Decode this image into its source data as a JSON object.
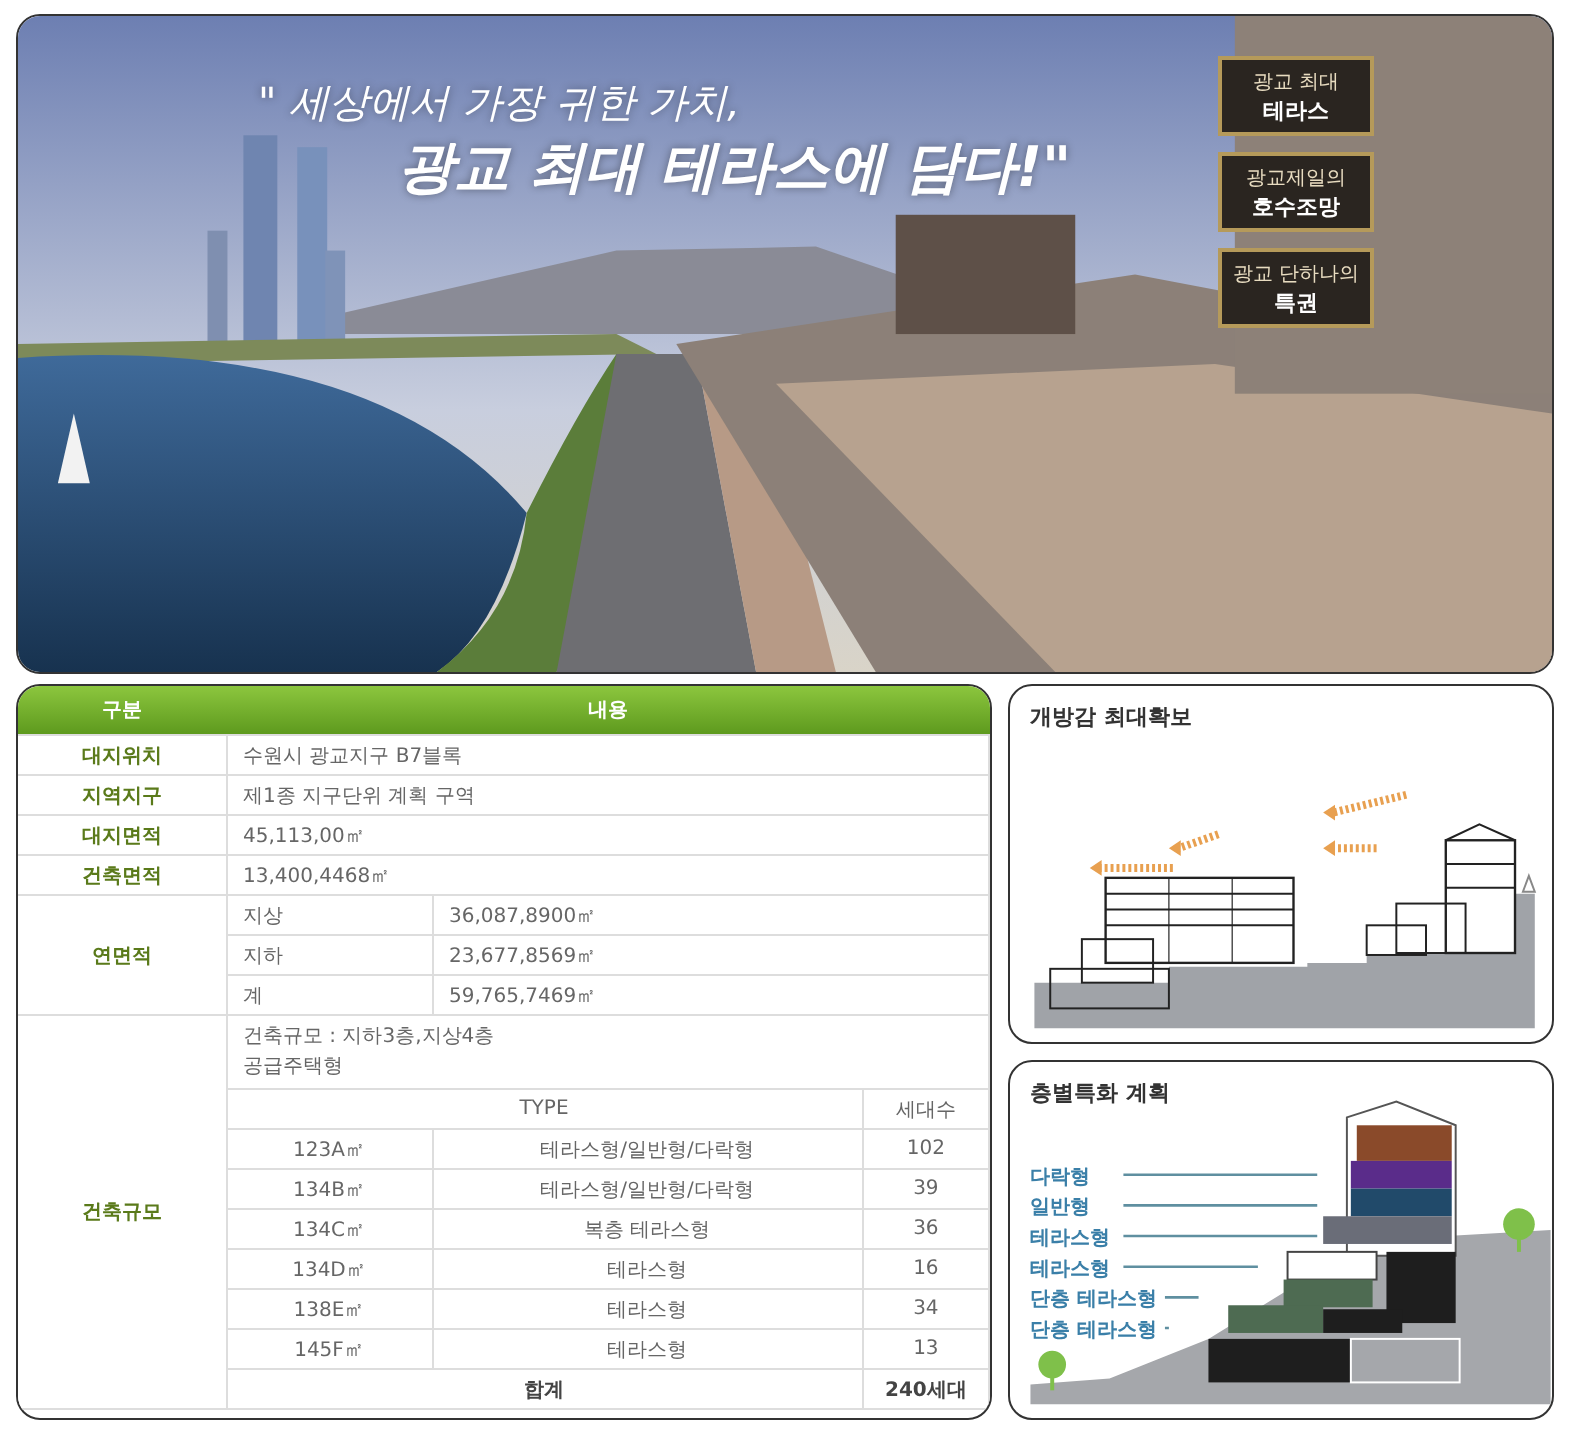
{
  "banner": {
    "slogan_line_1": "\" 세상에서 가장 귀한 가치,",
    "slogan_line_2": "광교 최대 테라스에 담다!\"",
    "badges": [
      {
        "line_1": "광교 최대",
        "line_2": "테라스"
      },
      {
        "line_1": "광교제일의",
        "line_2": "호수조망"
      },
      {
        "line_1": "광교 단하나의",
        "line_2": "특권"
      }
    ]
  },
  "spec_table": {
    "columns": [
      "구분",
      "내용"
    ],
    "rows": [
      {
        "label": "대지위치",
        "value": "수원시 광교지구 B7블록"
      },
      {
        "label": "지역지구",
        "value": "제1종 지구단위 계획 구역"
      },
      {
        "label": "대지면적",
        "value": "45,113,00㎡"
      },
      {
        "label": "건축면적",
        "value": "13,400,4468㎡"
      }
    ],
    "floor_area": {
      "label": "연면적",
      "items": [
        {
          "label": "지상",
          "value": "36,087,8900㎡"
        },
        {
          "label": "지하",
          "value": "23,677,8569㎡"
        },
        {
          "label": "계",
          "value": "59,765,7469㎡"
        }
      ]
    },
    "scale": {
      "label": "건축규모",
      "lines": [
        "건축규모 : 지하3층,지상4층",
        "공급주택형"
      ],
      "type_columns": [
        "TYPE",
        "세대수"
      ],
      "types": [
        {
          "type": "123A㎡",
          "form": "테라스형/일반형/다락형",
          "units": "102"
        },
        {
          "type": "134B㎡",
          "form": "테라스형/일반형/다락형",
          "units": "39"
        },
        {
          "type": "134C㎡",
          "form": "복층 테라스형",
          "units": "36"
        },
        {
          "type": "134D㎡",
          "form": "테라스형",
          "units": "16"
        },
        {
          "type": "138E㎡",
          "form": "테라스형",
          "units": "34"
        },
        {
          "type": "145F㎡",
          "form": "테라스형",
          "units": "13"
        }
      ],
      "total": {
        "label": "합계",
        "value": "240세대"
      }
    }
  },
  "diagrams": [
    {
      "kind": "openness",
      "title": "개방감 최대확보"
    },
    {
      "kind": "floors",
      "title": "층별특화 계획",
      "labels": [
        "다락형",
        "일반형",
        "테라스형",
        "테라스형",
        "단층 테라스형",
        "단층 테라스형"
      ]
    }
  ]
}
